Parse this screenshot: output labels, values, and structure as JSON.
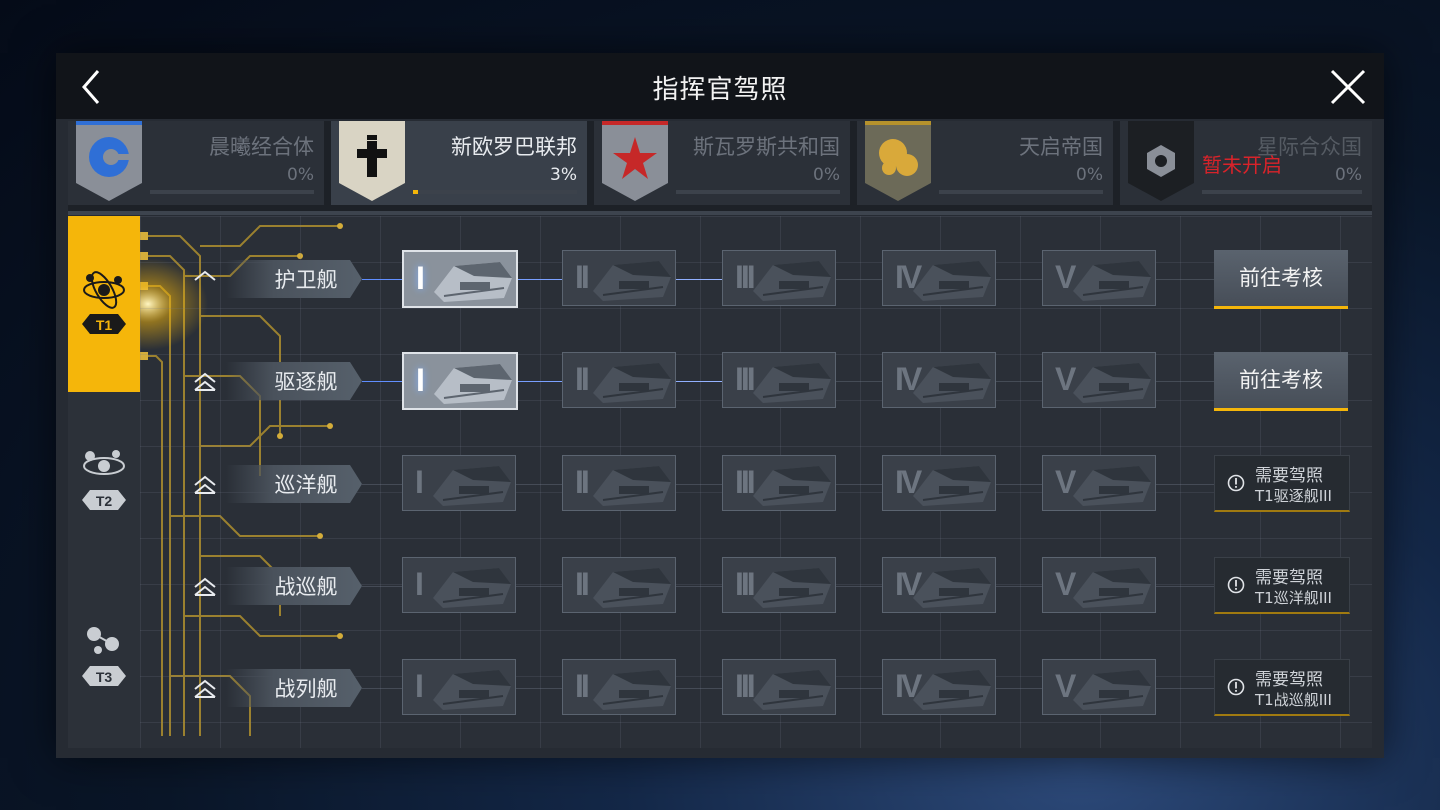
{
  "title": "指挥官驾照",
  "colors": {
    "accent": "#f5b60a",
    "locked_text": "#d8232a",
    "panel_bg": "#262b33"
  },
  "icons": {
    "back": "chevron-left-icon",
    "close": "close-x-icon"
  },
  "factions": [
    {
      "name": "晨曦经合体",
      "percent": "0%",
      "progress": 0,
      "emblem": "circle-emblem-icon"
    },
    {
      "name": "新欧罗巴联邦",
      "percent": "3%",
      "progress": 0.03,
      "emblem": "cross-emblem-icon",
      "active": true
    },
    {
      "name": "斯瓦罗斯共和国",
      "percent": "0%",
      "progress": 0,
      "emblem": "star-emblem-icon"
    },
    {
      "name": "天启帝国",
      "percent": "0%",
      "progress": 0,
      "emblem": "spheres-emblem-icon"
    },
    {
      "name": "星际合众国",
      "percent": "0%",
      "progress": 0,
      "emblem": "hexagon-emblem-icon",
      "locked_label": "暂未开启"
    }
  ],
  "tiers": [
    {
      "label": "T1",
      "active": true
    },
    {
      "label": "T2"
    },
    {
      "label": "T3"
    }
  ],
  "numerals": [
    "I",
    "II",
    "III",
    "IV",
    "V"
  ],
  "rows": [
    {
      "name": "护卫舰",
      "unlocked_level": 1,
      "action": "前往考核"
    },
    {
      "name": "驱逐舰",
      "unlocked_level": 1,
      "action": "前往考核"
    },
    {
      "name": "巡洋舰",
      "unlocked_level": 0,
      "requirement_line1": "需要驾照",
      "requirement_line2": "T1驱逐舰III"
    },
    {
      "name": "战巡舰",
      "unlocked_level": 0,
      "requirement_line1": "需要驾照",
      "requirement_line2": "T1巡洋舰III"
    },
    {
      "name": "战列舰",
      "unlocked_level": 0,
      "requirement_line1": "需要驾照",
      "requirement_line2": "T1战巡舰III"
    }
  ]
}
